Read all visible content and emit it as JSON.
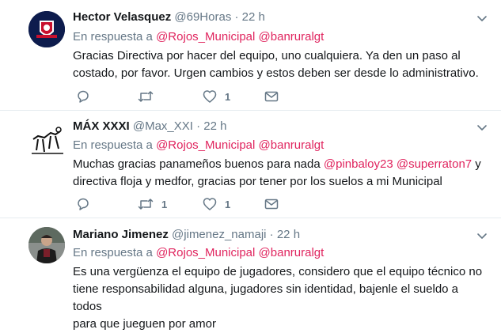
{
  "tweets": [
    {
      "name": "Hector Velasquez",
      "handle": "@69Horas",
      "dot": "·",
      "time": "22 h",
      "reply_prefix": "En respuesta a",
      "mentions": [
        "@Rojos_Municipal",
        "@banruralgt"
      ],
      "text_lines": [
        "Gracias Directiva por hacer del equipo, uno cualquiera. Ya den un paso al",
        "costado, por favor. Urgen cambios y estos deben ser desde lo administrativo."
      ],
      "retweets": "",
      "likes": "1"
    },
    {
      "name": "MÁX XXXI",
      "handle": "@Max_XXI",
      "dot": "·",
      "time": "22 h",
      "reply_prefix": "En respuesta a",
      "mentions": [
        "@Rojos_Municipal",
        "@banruralgt"
      ],
      "text_parts": {
        "line1_a": "Muchas gracias panameños buenos para nada ",
        "line1_m1": "@pinbaloy23",
        "line1_sp": " ",
        "line1_m2": "@superraton7",
        "line1_b": " y",
        "line2": "directiva floja y medfor, gracias por tener por los suelos a mi Municipal"
      },
      "retweets": "1",
      "likes": "1"
    },
    {
      "name": "Mariano Jimenez",
      "handle": "@jimenez_namaji",
      "dot": "·",
      "time": "22 h",
      "reply_prefix": "En respuesta a",
      "mentions": [
        "@Rojos_Municipal",
        "@banruralgt"
      ],
      "text_lines": [
        "Es una vergüenza el equipo de jugadores, considero que el equipo técnico no",
        "tiene responsabilidad alguna, jugadores sin identidad, bajenle el sueldo a todos",
        "para que jueguen por amor"
      ]
    }
  ],
  "icons": {
    "reply": "reply-icon",
    "retweet": "retweet-icon",
    "like": "heart-icon",
    "dm": "envelope-icon",
    "more": "chevron-down-icon"
  },
  "colors": {
    "mention": "#e0245e",
    "secondary": "#657786",
    "divider": "#e6ecf0"
  }
}
